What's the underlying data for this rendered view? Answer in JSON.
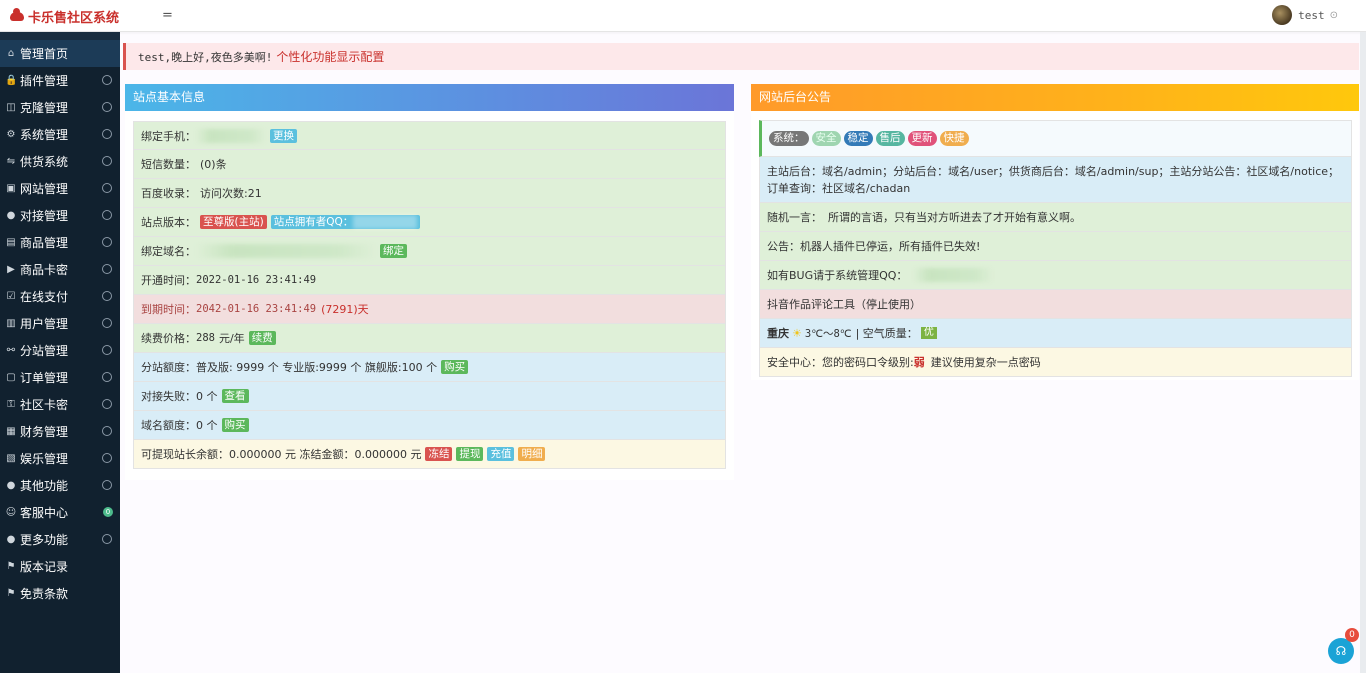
{
  "header": {
    "brand": "卡乐售社区系统",
    "menu_toggle": "=",
    "username": "test",
    "user_caret": "⊙"
  },
  "sidebar": {
    "items": [
      {
        "label": "管理首页",
        "icon": "home-icon",
        "glyph": "⌂",
        "active": true,
        "arrow": ""
      },
      {
        "label": "插件管理",
        "icon": "lock-icon",
        "glyph": "🔒",
        "arrow": "◦"
      },
      {
        "label": "克隆管理",
        "icon": "clone-icon",
        "glyph": "◫",
        "arrow": "◦"
      },
      {
        "label": "系统管理",
        "icon": "gear-icon",
        "glyph": "⚙",
        "arrow": "◦"
      },
      {
        "label": "供货系统",
        "icon": "supply-icon",
        "glyph": "⇋",
        "arrow": "◦"
      },
      {
        "label": "网站管理",
        "icon": "website-icon",
        "glyph": "▣",
        "arrow": "◦"
      },
      {
        "label": "对接管理",
        "icon": "link-icon",
        "glyph": "●",
        "arrow": "◦"
      },
      {
        "label": "商品管理",
        "icon": "goods-icon",
        "glyph": "▤",
        "arrow": "◦"
      },
      {
        "label": "商品卡密",
        "icon": "card-icon",
        "glyph": "▶",
        "arrow": "◦"
      },
      {
        "label": "在线支付",
        "icon": "pay-icon",
        "glyph": "☑",
        "arrow": "◦"
      },
      {
        "label": "用户管理",
        "icon": "users-icon",
        "glyph": "▥",
        "arrow": "◦"
      },
      {
        "label": "分站管理",
        "icon": "branch-icon",
        "glyph": "⚯",
        "arrow": "◦"
      },
      {
        "label": "订单管理",
        "icon": "order-icon",
        "glyph": "▢",
        "arrow": "◦"
      },
      {
        "label": "社区卡密",
        "icon": "community-icon",
        "glyph": "⚿",
        "arrow": "◦"
      },
      {
        "label": "财务管理",
        "icon": "finance-icon",
        "glyph": "▦",
        "arrow": "◦"
      },
      {
        "label": "娱乐管理",
        "icon": "game-icon",
        "glyph": "▧",
        "arrow": "◦"
      },
      {
        "label": "其他功能",
        "icon": "apple-icon",
        "glyph": "●",
        "arrow": "◦"
      },
      {
        "label": "客服中心",
        "icon": "support-icon",
        "glyph": "☺",
        "arrow": "",
        "count": "0"
      },
      {
        "label": "更多功能",
        "icon": "apple-icon",
        "glyph": "●",
        "arrow": "◦"
      },
      {
        "label": "版本记录",
        "icon": "flag-icon",
        "glyph": "⚑",
        "arrow": ""
      },
      {
        "label": "免责条款",
        "icon": "flag-icon",
        "glyph": "⚑",
        "arrow": ""
      }
    ]
  },
  "welcome": {
    "text": "test,晚上好,夜色多美啊!",
    "link": "个性化功能显示配置"
  },
  "site_info": {
    "title": "站点基本信息",
    "phone_label": "绑定手机：",
    "phone_btn": "更换",
    "sms_label": "短信数量：",
    "sms_value": "(0)条",
    "baidu_label": "百度收录：",
    "baidu_value": "访问次数:21",
    "version_label": "站点版本：",
    "version_badge": "至尊版(主站)",
    "owner_badge_prefix": "站点拥有者QQ：",
    "domain_label": "绑定域名：",
    "domain_btn": "绑定",
    "open_label": "开通时间：",
    "open_value": "2022-01-16 23:41:49",
    "expire_label": "到期时间：",
    "expire_value": "2042-01-16 23:41:49",
    "expire_days": "(7291)天",
    "renew_label": "续费价格：",
    "renew_value": "288",
    "renew_unit": "元/年",
    "renew_btn": "续费",
    "quota_text": "分站额度：普及版: 9999 个 专业版:9999 个 旗舰版:100 个",
    "quota_btn": "购买",
    "fail_text": "对接失败：0 个",
    "fail_btn": "查看",
    "domain_quota_text": "域名额度：0 个",
    "domain_quota_btn": "购买",
    "balance_text": "可提现站长余额：0.000000 元 冻结金额：0.000000 元",
    "btn_freeze": "冻结",
    "btn_withdraw": "提现",
    "btn_recharge": "充值",
    "btn_detail": "明细"
  },
  "notice": {
    "title": "网站后台公告",
    "status_label": "系统：",
    "tags": [
      "安全",
      "稳定",
      "售后",
      "更新",
      "快捷"
    ],
    "row1": "主站后台：域名/admin；分站后台：域名/user；供货商后台：域名/admin/sup；主站分站公告：社区域名/notice；订单查询：社区域名/chadan",
    "row2_label": "随机一言：",
    "row2_text": "所谓的言语，只有当对方听进去了才开始有意义啊。",
    "row3": "公告：机器人插件已停运，所有插件已失效!",
    "row4": "如有BUG请于系统管理QQ：",
    "row5": "抖音作品评论工具（停止使用）",
    "weather_city": "重庆",
    "weather_temp": "3℃～8℃",
    "weather_aqi_label": "| 空气质量：",
    "weather_aqi": "优",
    "security_text": "安全中心：您的密码口令级别:",
    "security_level": "弱",
    "security_tip": "建议使用复杂一点密码"
  },
  "chat": {
    "badge": "0"
  }
}
